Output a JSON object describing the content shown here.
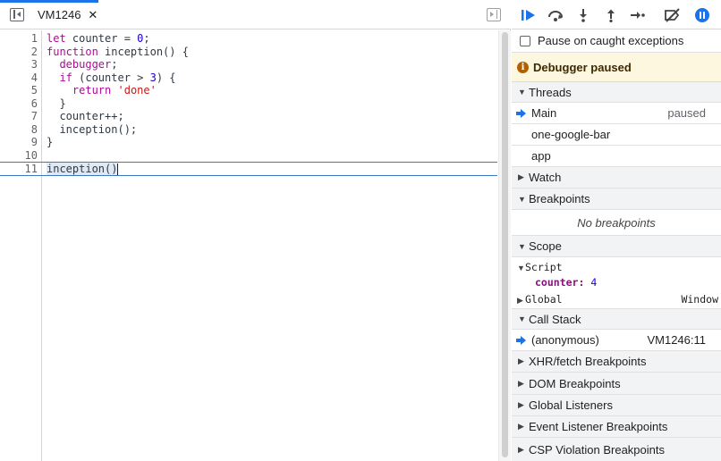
{
  "editor": {
    "tab": {
      "label": "VM1246",
      "close": "✕"
    },
    "lines": [
      {
        "n": "1"
      },
      {
        "n": "2"
      },
      {
        "n": "3"
      },
      {
        "n": "4"
      },
      {
        "n": "5"
      },
      {
        "n": "6"
      },
      {
        "n": "7"
      },
      {
        "n": "8"
      },
      {
        "n": "9"
      },
      {
        "n": "10"
      },
      {
        "n": "11"
      }
    ],
    "code": {
      "l1_a": "let counter = ",
      "l1_num": "0",
      "l1_b": ";",
      "l2_kw": "function",
      "l2_b": " inception() {",
      "l3_kw": "debugger",
      "l3_b": ";",
      "l4_kw": "if",
      "l4_b": " (counter > ",
      "l4_num": "3",
      "l4_c": ") {",
      "l5_kw": "return",
      "l5_str": "'done'",
      "l6": "}",
      "l7": "counter++;",
      "l8": "inception();",
      "l9": "}",
      "l11_exec": "inception",
      "l11_rest": "()"
    }
  },
  "sidebar": {
    "pause_on_caught": "Pause on caught exceptions",
    "paused_banner": "Debugger paused",
    "info_glyph": "i",
    "threads": {
      "title": "Threads",
      "items": [
        {
          "label": "Main",
          "status": "paused"
        },
        {
          "label": "one-google-bar",
          "status": ""
        },
        {
          "label": "app",
          "status": ""
        }
      ]
    },
    "watch": {
      "title": "Watch"
    },
    "breakpoints": {
      "title": "Breakpoints",
      "empty": "No breakpoints"
    },
    "scope": {
      "title": "Scope",
      "script_label": "Script",
      "counter_name": "counter:",
      "counter_value": "4",
      "global_label": "Global",
      "global_value": "Window"
    },
    "call_stack": {
      "title": "Call Stack",
      "frame_name": "(anonymous)",
      "frame_location": "VM1246:11"
    },
    "sections": {
      "xhr": "XHR/fetch Breakpoints",
      "dom": "DOM Breakpoints",
      "global_listeners": "Global Listeners",
      "event_listener": "Event Listener Breakpoints",
      "csp": "CSP Violation Breakpoints"
    },
    "glyphs": {
      "expanded": "▼",
      "collapsed": "▶"
    }
  },
  "colors": {
    "accent": "#1a73e8",
    "paused_banner_bg": "#fef7e0",
    "keyword": "#aa0d91",
    "number": "#1c00cf",
    "string": "#c41a16"
  },
  "icons": {
    "toolbar": [
      "resume-icon",
      "step-over-icon",
      "step-into-icon",
      "step-out-icon",
      "step-icon",
      "deactivate-breakpoints-icon",
      "pause-on-exceptions-icon"
    ]
  }
}
